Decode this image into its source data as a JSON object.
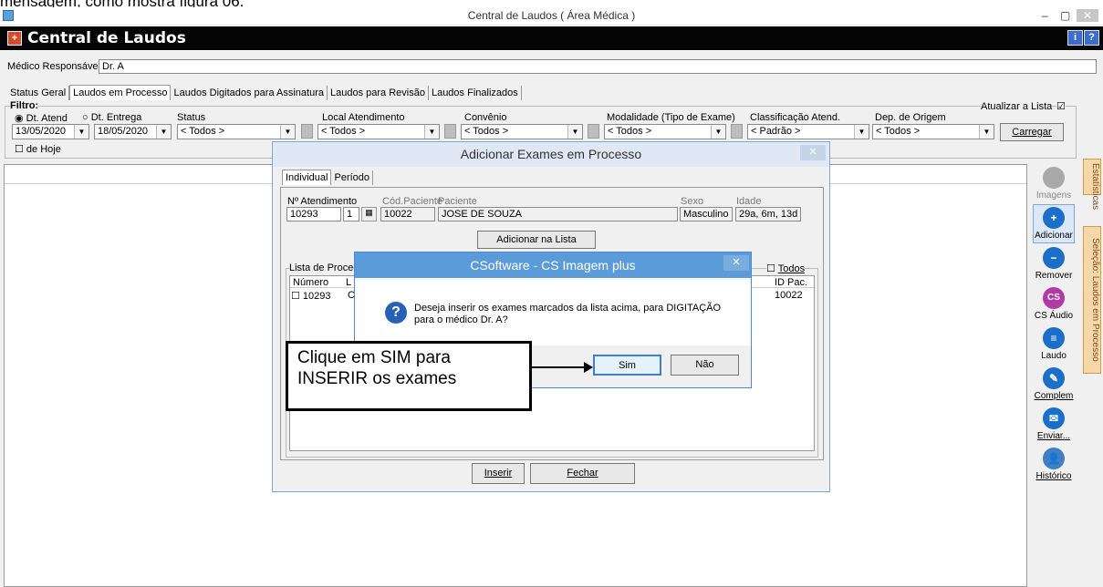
{
  "top_caption": "mensagem, como mostra figura 06.",
  "window": {
    "title": "Central de Laudos ( Área Médica )",
    "minimize": "–",
    "restore": "▢",
    "close": "✕"
  },
  "app": {
    "title": "Central de Laudos",
    "help_btn": "?",
    "info_btn": "i"
  },
  "medico": {
    "label": "Médico Responsável:",
    "value": "Dr. A"
  },
  "tabs": [
    "Status Geral",
    "Laudos em Processo",
    "Laudos Digitados para Assinatura",
    "Laudos para Revisão",
    "Laudos Finalizados"
  ],
  "filtro": {
    "label": "Filtro:",
    "radio_atend": "Dt. Atend",
    "radio_entrega": "Dt. Entrega",
    "date_from": "13/05/2020",
    "date_to": "18/05/2020",
    "de_hoje": "de Hoje",
    "status_label": "Status",
    "status_value": "< Todos >",
    "local_label": "Local Atendimento",
    "local_value": "< Todos >",
    "convenio_label": "Convênio",
    "convenio_value": "< Todos >",
    "modalidade_label": "Modalidade (Tipo de Exame)",
    "modalidade_value": "< Todos >",
    "classificacao_label": "Classificação Atend.",
    "classificacao_value": "< Padrão >",
    "dep_label": "Dep. de Origem",
    "dep_value": "< Todos >",
    "atualizar_label": "Atualizar a Lista",
    "carregar": "Carregar"
  },
  "sidebar": {
    "imagens": "Imagens",
    "adicionar": "Adicionar",
    "remover": "Remover",
    "cs_audio": "CS Áudio",
    "laudo": "Laudo",
    "complem": "Complem",
    "enviar": "Enviar...",
    "historico": "Histórico",
    "cs_icon_text": "CS"
  },
  "vtabs": {
    "estatisticas": "Estatísticas",
    "selecao": "Seleção: Laudos em Processo"
  },
  "add_dialog": {
    "title": "Adicionar Exames em Processo",
    "close": "✕",
    "tab_individual": "Individual",
    "tab_periodo": "Período",
    "atend_label": "Nº Atendimento",
    "atend_value": "10293",
    "atend_seq": "1",
    "cod_paciente_label": "Cód.Paciente",
    "cod_paciente_value": "10022",
    "paciente_label": "Paciente",
    "paciente_value": "JOSE DE SOUZA",
    "sexo_label": "Sexo",
    "sexo_value": "Masculino",
    "idade_label": "Idade",
    "idade_value": "29a, 6m, 13d",
    "add_list_btn": "Adicionar na Lista",
    "lista_label": "Lista de Procedir",
    "todos_label": "Todos",
    "col_numero": "Número",
    "col_l": "L",
    "col_id_pac": "ID Pac.",
    "row_numero": "10293",
    "row_l": "C",
    "row_id_pac": "10022",
    "inserir": "Inserir",
    "fechar": "Fechar"
  },
  "confirm_dialog": {
    "title": "CSoftware - CS Imagem plus",
    "close": "✕",
    "message": "Deseja inserir os exames marcados da lista acima, para DIGITAÇÃO para o médico Dr. A?",
    "icon": "?",
    "sim": "Sim",
    "nao": "Não"
  },
  "callout": {
    "text": "Clique em SIM para INSERIR os exames"
  }
}
